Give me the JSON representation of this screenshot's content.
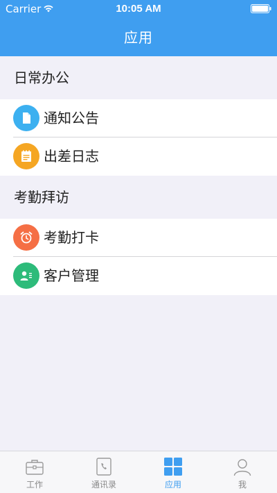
{
  "status_bar": {
    "carrier": "Carrier",
    "time": "10:05 AM"
  },
  "nav": {
    "title": "应用"
  },
  "sections": [
    {
      "title": "日常办公",
      "items": [
        {
          "label": "通知公告",
          "icon": "document-icon",
          "color": "#3cb0f0"
        },
        {
          "label": "出差日志",
          "icon": "notepad-icon",
          "color": "#f5a623"
        }
      ]
    },
    {
      "title": "考勤拜访",
      "items": [
        {
          "label": "考勤打卡",
          "icon": "alarm-clock-icon",
          "color": "#f56f45"
        },
        {
          "label": "客户管理",
          "icon": "contact-card-icon",
          "color": "#2dbb7a"
        }
      ]
    }
  ],
  "tabbar": {
    "items": [
      {
        "label": "工作",
        "icon": "briefcase-icon",
        "active": false
      },
      {
        "label": "通讯录",
        "icon": "address-book-icon",
        "active": false
      },
      {
        "label": "应用",
        "icon": "grid-icon",
        "active": true
      },
      {
        "label": "我",
        "icon": "user-icon",
        "active": false
      }
    ]
  },
  "colors": {
    "primary": "#3f9ef0",
    "background": "#f1f0f8",
    "inactive_tab": "#8a8a8a"
  }
}
